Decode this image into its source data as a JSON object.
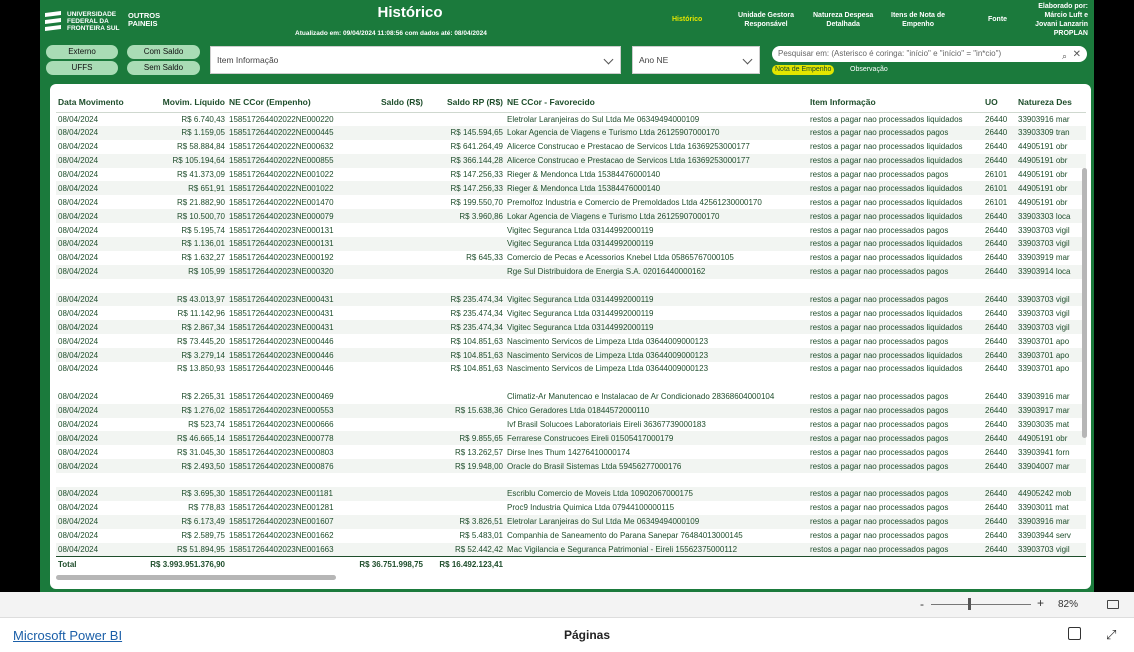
{
  "header": {
    "logo_text": "UNIVERSIDADE\nFEDERAL DA\nFRONTEIRA SUL",
    "outros": "OUTROS\nPAINEIS",
    "title": "Histórico",
    "updated": "Atualizado em: 09/04/2024 11:08:56 com dados até: 08/04/2024",
    "nav": [
      {
        "label": "Histórico"
      },
      {
        "label": "Unidade Gestora\nResponsável"
      },
      {
        "label": "Natureza Despesa\nDetalhada"
      },
      {
        "label": "Itens de Nota de\nEmpenho"
      },
      {
        "label": "Fonte"
      }
    ],
    "elaborado": "Elaborado por:\nMárcio Luft e\nJovani Lanzarin\nPROPLAN"
  },
  "filters": {
    "externo": "Externo",
    "uffs": "UFFS",
    "com_saldo": "Com Saldo",
    "sem_saldo": "Sem Saldo",
    "item_informacao": "Item Informação",
    "ano_ne": "Ano NE",
    "search_placeholder": "Pesquisar em: (Asterisco é coringa: \"início\" e \"início\" = \"in*cio\")",
    "tag_on": "Nota de Empenho",
    "tag_off": "Observação"
  },
  "table": {
    "columns": [
      "Data Movimento",
      "Movim. Líquido",
      "NE CCor (Empenho)",
      "Saldo (R$)",
      "Saldo RP (R$)",
      "NE CCor - Favorecido",
      "Item Informação",
      "UO",
      "Natureza Des"
    ],
    "rows": [
      [
        "08/04/2024",
        "R$ 6.740,43",
        "158517264402022NE000220",
        "",
        "",
        "Eletrolar Laranjeiras do Sul Ltda Me 06349494000109",
        "restos a pagar nao processados liquidados",
        "26440",
        "33903916 mar"
      ],
      [
        "08/04/2024",
        "R$ 1.159,05",
        "158517264402022NE000445",
        "",
        "R$ 145.594,65",
        "Lokar Agencia de Viagens e Turismo Ltda 26125907000170",
        "restos a pagar nao processados pagos",
        "26440",
        "33903309 tran"
      ],
      [
        "08/04/2024",
        "R$ 58.884,84",
        "158517264402022NE000632",
        "",
        "R$ 641.264,49",
        "Alicerce Construcao e Prestacao de Servicos Ltda 16369253000177",
        "restos a pagar nao processados liquidados",
        "26440",
        "44905191 obr"
      ],
      [
        "08/04/2024",
        "R$ 105.194,64",
        "158517264402022NE000855",
        "",
        "R$ 366.144,28",
        "Alicerce Construcao e Prestacao de Servicos Ltda 16369253000177",
        "restos a pagar nao processados liquidados",
        "26440",
        "44905191 obr"
      ],
      [
        "08/04/2024",
        "R$ 41.373,09",
        "158517264402022NE001022",
        "",
        "R$ 147.256,33",
        "Rieger & Mendonca Ltda 15384476000140",
        "restos a pagar nao processados pagos",
        "26101",
        "44905191 obr"
      ],
      [
        "08/04/2024",
        "R$ 651,91",
        "158517264402022NE001022",
        "",
        "R$ 147.256,33",
        "Rieger & Mendonca Ltda 15384476000140",
        "restos a pagar nao processados liquidados",
        "26101",
        "44905191 obr"
      ],
      [
        "08/04/2024",
        "R$ 21.882,90",
        "158517264402022NE001470",
        "",
        "R$ 199.550,70",
        "Premolfoz Industria e Comercio de Premoldados Ltda 42561230000170",
        "restos a pagar nao processados liquidados",
        "26101",
        "44905191 obr"
      ],
      [
        "08/04/2024",
        "R$ 10.500,70",
        "158517264402023NE000079",
        "",
        "R$ 3.960,86",
        "Lokar Agencia de Viagens e Turismo Ltda 26125907000170",
        "restos a pagar nao processados liquidados",
        "26440",
        "33903303 loca"
      ],
      [
        "08/04/2024",
        "R$ 5.195,74",
        "158517264402023NE000131",
        "",
        "",
        "Vigitec Seguranca Ltda 03144992000119",
        "restos a pagar nao processados pagos",
        "26440",
        "33903703 vigil"
      ],
      [
        "08/04/2024",
        "R$ 1.136,01",
        "158517264402023NE000131",
        "",
        "",
        "Vigitec Seguranca Ltda 03144992000119",
        "restos a pagar nao processados liquidados",
        "26440",
        "33903703 vigil"
      ],
      [
        "08/04/2024",
        "R$ 1.632,27",
        "158517264402023NE000192",
        "",
        "R$ 645,33",
        "Comercio de Pecas e Acessorios Knebel Ltda 05865767000105",
        "restos a pagar nao processados liquidados",
        "26440",
        "33903919 mar"
      ],
      [
        "08/04/2024",
        "R$ 105,99",
        "158517264402023NE000320",
        "",
        "",
        "Rge Sul Distribuidora de Energia S.A. 02016440000162",
        "restos a pagar nao processados pagos",
        "26440",
        "33903914 loca"
      ],
      [
        "",
        "",
        "",
        "",
        "",
        "",
        "",
        "",
        ""
      ],
      [
        "08/04/2024",
        "R$ 43.013,97",
        "158517264402023NE000431",
        "",
        "R$ 235.474,34",
        "Vigitec Seguranca Ltda 03144992000119",
        "restos a pagar nao processados pagos",
        "26440",
        "33903703 vigil"
      ],
      [
        "08/04/2024",
        "R$ 11.142,96",
        "158517264402023NE000431",
        "",
        "R$ 235.474,34",
        "Vigitec Seguranca Ltda 03144992000119",
        "restos a pagar nao processados liquidados",
        "26440",
        "33903703 vigil"
      ],
      [
        "08/04/2024",
        "R$ 2.867,34",
        "158517264402023NE000431",
        "",
        "R$ 235.474,34",
        "Vigitec Seguranca Ltda 03144992000119",
        "restos a pagar nao processados liquidados",
        "26440",
        "33903703 vigil"
      ],
      [
        "08/04/2024",
        "R$ 73.445,20",
        "158517264402023NE000446",
        "",
        "R$ 104.851,63",
        "Nascimento Servicos de Limpeza Ltda 03644009000123",
        "restos a pagar nao processados pagos",
        "26440",
        "33903701 apo"
      ],
      [
        "08/04/2024",
        "R$ 3.279,14",
        "158517264402023NE000446",
        "",
        "R$ 104.851,63",
        "Nascimento Servicos de Limpeza Ltda 03644009000123",
        "restos a pagar nao processados liquidados",
        "26440",
        "33903701 apo"
      ],
      [
        "08/04/2024",
        "R$ 13.850,93",
        "158517264402023NE000446",
        "",
        "R$ 104.851,63",
        "Nascimento Servicos de Limpeza Ltda 03644009000123",
        "restos a pagar nao processados liquidados",
        "26440",
        "33903701 apo"
      ],
      [
        "",
        "",
        "",
        "",
        "",
        "",
        "",
        "",
        ""
      ],
      [
        "08/04/2024",
        "R$ 2.265,31",
        "158517264402023NE000469",
        "",
        "",
        "Climatiz-Ar Manutencao e Instalacao de Ar Condicionado 28368604000104",
        "restos a pagar nao processados pagos",
        "26440",
        "33903916 mar"
      ],
      [
        "08/04/2024",
        "R$ 1.276,02",
        "158517264402023NE000553",
        "",
        "R$ 15.638,36",
        "Chico Geradores Ltda 01844572000110",
        "restos a pagar nao processados pagos",
        "26440",
        "33903917 mar"
      ],
      [
        "08/04/2024",
        "R$ 523,74",
        "158517264402023NE000666",
        "",
        "",
        "Ivf Brasil Solucoes Laboratoriais Eireli 36367739000183",
        "restos a pagar nao processados pagos",
        "26440",
        "33903035 mat"
      ],
      [
        "08/04/2024",
        "R$ 46.665,14",
        "158517264402023NE000778",
        "",
        "R$ 9.855,65",
        "Ferrarese Construcoes Eireli 01505417000179",
        "restos a pagar nao processados pagos",
        "26440",
        "44905191 obr"
      ],
      [
        "08/04/2024",
        "R$ 31.045,30",
        "158517264402023NE000803",
        "",
        "R$ 13.262,57",
        "Dirse Ines Thum 14276410000174",
        "restos a pagar nao processados pagos",
        "26440",
        "33903941 forn"
      ],
      [
        "08/04/2024",
        "R$ 2.493,50",
        "158517264402023NE000876",
        "",
        "R$ 19.948,00",
        "Oracle do Brasil Sistemas Ltda 59456277000176",
        "restos a pagar nao processados pagos",
        "26440",
        "33904007 mar"
      ],
      [
        "",
        "",
        "",
        "",
        "",
        "",
        "",
        "",
        ""
      ],
      [
        "08/04/2024",
        "R$ 3.695,30",
        "158517264402023NE001181",
        "",
        "",
        "Escriblu Comercio de Moveis Ltda 10902067000175",
        "restos a pagar nao processados pagos",
        "26440",
        "44905242 mob"
      ],
      [
        "08/04/2024",
        "R$ 778,83",
        "158517264402023NE001281",
        "",
        "",
        "Proc9 Industria Quimica Ltda 07944100000115",
        "restos a pagar nao processados pagos",
        "26440",
        "33903011 mat"
      ],
      [
        "08/04/2024",
        "R$ 6.173,49",
        "158517264402023NE001607",
        "",
        "R$ 3.826,51",
        "Eletrolar Laranjeiras do Sul Ltda Me 06349494000109",
        "restos a pagar nao processados pagos",
        "26440",
        "33903916 mar"
      ],
      [
        "08/04/2024",
        "R$ 2.589,75",
        "158517264402023NE001662",
        "",
        "R$ 5.483,01",
        "Companhia de Saneamento do Parana Sanepar 76484013000145",
        "restos a pagar nao processados pagos",
        "26440",
        "33903944 serv"
      ],
      [
        "08/04/2024",
        "R$ 51.894,95",
        "158517264402023NE001663",
        "",
        "R$ 52.442,42",
        "Mac Vigilancia e Seguranca Patrimonial - Eireli 15562375000112",
        "restos a pagar nao processados pagos",
        "26440",
        "33903703 vigil"
      ]
    ],
    "total": [
      "Total",
      "R$ 3.993.951.376,90",
      "",
      "R$ 36.751.998,75",
      "R$ 16.492.123,41",
      "",
      "",
      "",
      ""
    ]
  },
  "zoom": {
    "minus": "-",
    "plus": "+",
    "percent": "82%"
  },
  "footer": {
    "brand": "Microsoft Power BI",
    "pages": "Páginas"
  },
  "colors": {
    "brand_green": "#1b7a3c",
    "text_green": "#1f4e2c",
    "accent_yellow": "#e3e600"
  }
}
